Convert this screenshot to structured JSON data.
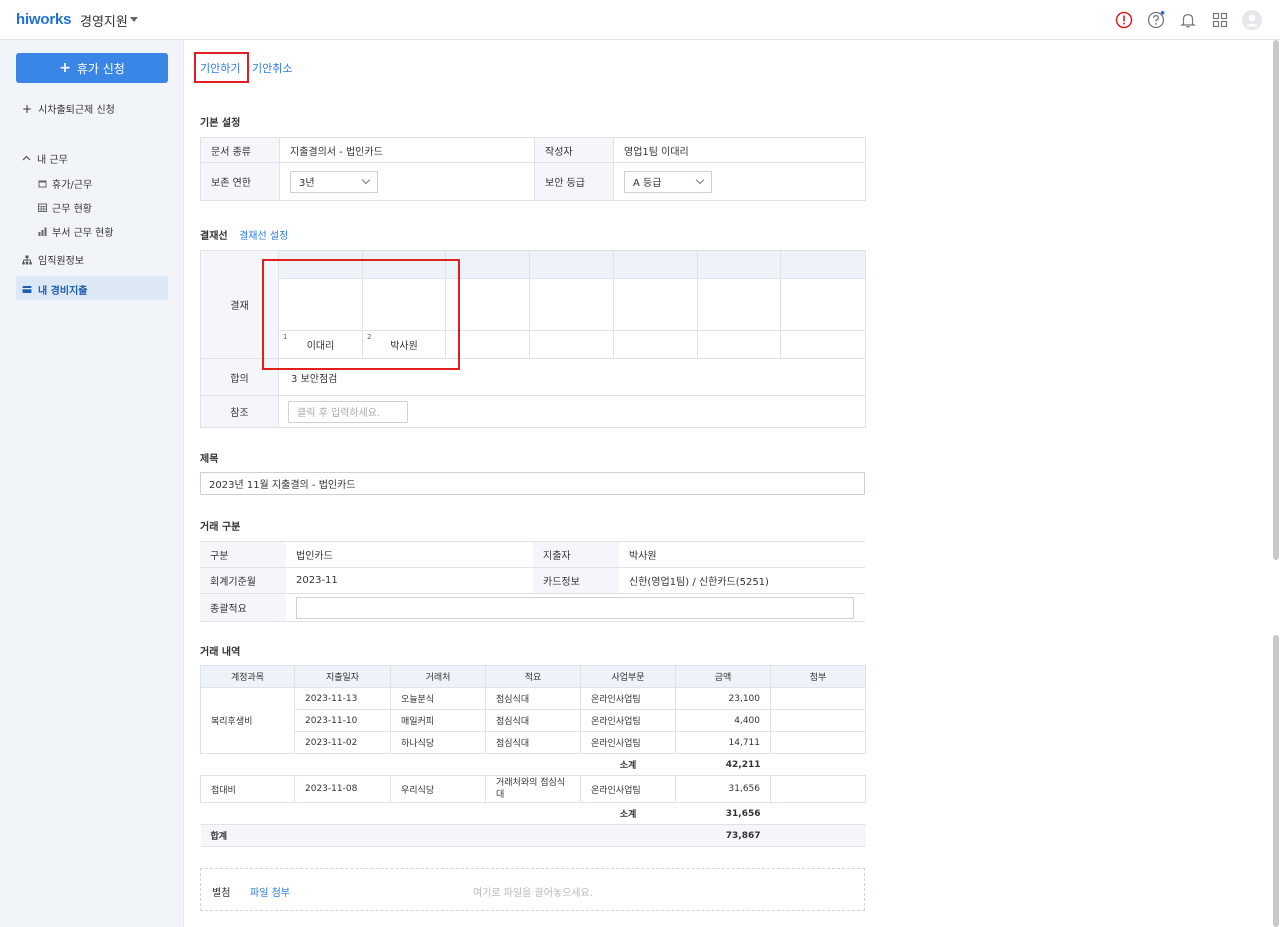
{
  "topbar": {
    "logo": "hiworks",
    "app_name": "경영지원",
    "icons": [
      "alert-icon",
      "help-icon",
      "bell-icon",
      "apps-grid-icon",
      "avatar"
    ],
    "accent_color": "#1f6fd6",
    "alert_color": "#e02020"
  },
  "sidebar": {
    "primary_button": "휴가 신청",
    "flex_request": "시차출퇴근제 신청",
    "my_work": "내 근무",
    "sub_items": [
      "휴가/근무",
      "근무 현황",
      "부서 근무 현황"
    ],
    "employee_info": "임직원정보",
    "my_expense": "내 경비지출"
  },
  "tabs": {
    "draft": "기안하기",
    "cancel": "기안취소"
  },
  "basic": {
    "title": "기본 설정",
    "doc_type_label": "문서 종류",
    "doc_type_value": "지출결의서 - 법인카드",
    "author_label": "작성자",
    "author_value": "영업1팀 이대리",
    "retention_label": "보존 연한",
    "retention_value": "3년",
    "security_label": "보안 등급",
    "security_value": "A 등급"
  },
  "approval": {
    "title": "결재선",
    "setting_link": "결재선 설정",
    "row_label": "결재",
    "approvers": [
      {
        "no": "1",
        "name": "이대리"
      },
      {
        "no": "2",
        "name": "박사원"
      }
    ],
    "agree_label": "합의",
    "agree_value": "3 보안점검",
    "ref_label": "참조",
    "ref_placeholder": "클릭 후 입력하세요."
  },
  "subject": {
    "title": "제목",
    "value": "2023년 11월 지출결의 - 법인카드"
  },
  "transaction": {
    "title": "거래 구분",
    "type_label": "구분",
    "type_value": "법인카드",
    "spender_label": "지출자",
    "spender_value": "박사원",
    "month_label": "회계기준월",
    "month_value": "2023-11",
    "card_label": "카드정보",
    "card_value": "신한(영업1팀) / 신한카드(5251)",
    "summary_label": "종괄적요"
  },
  "details": {
    "title": "거래 내역",
    "headers": [
      "계정과목",
      "지출일자",
      "거래처",
      "적요",
      "사업부문",
      "금액",
      "첨부"
    ],
    "group1": {
      "account": "복리후생비",
      "rows": [
        {
          "date": "2023-11-13",
          "vendor": "오늘분식",
          "desc": "점심식대",
          "dept": "온라인사업팀",
          "amount": "23,100"
        },
        {
          "date": "2023-11-10",
          "vendor": "매일커피",
          "desc": "점심식대",
          "dept": "온라인사업팀",
          "amount": "4,400"
        },
        {
          "date": "2023-11-02",
          "vendor": "하나식당",
          "desc": "점심식대",
          "dept": "온라인사업팀",
          "amount": "14,711"
        }
      ],
      "subtotal_label": "소계",
      "subtotal": "42,211"
    },
    "group2": {
      "account": "접대비",
      "rows": [
        {
          "date": "2023-11-08",
          "vendor": "우리식당",
          "desc": "거래처와의 점심식대",
          "dept": "온라인사업팀",
          "amount": "31,656"
        }
      ],
      "subtotal_label": "소계",
      "subtotal": "31,656"
    },
    "total_label": "합계",
    "total": "73,867"
  },
  "attachment": {
    "label": "별첨",
    "link": "파일 첨부",
    "drop_hint": "여기로 파일을 끌어놓으세요."
  }
}
